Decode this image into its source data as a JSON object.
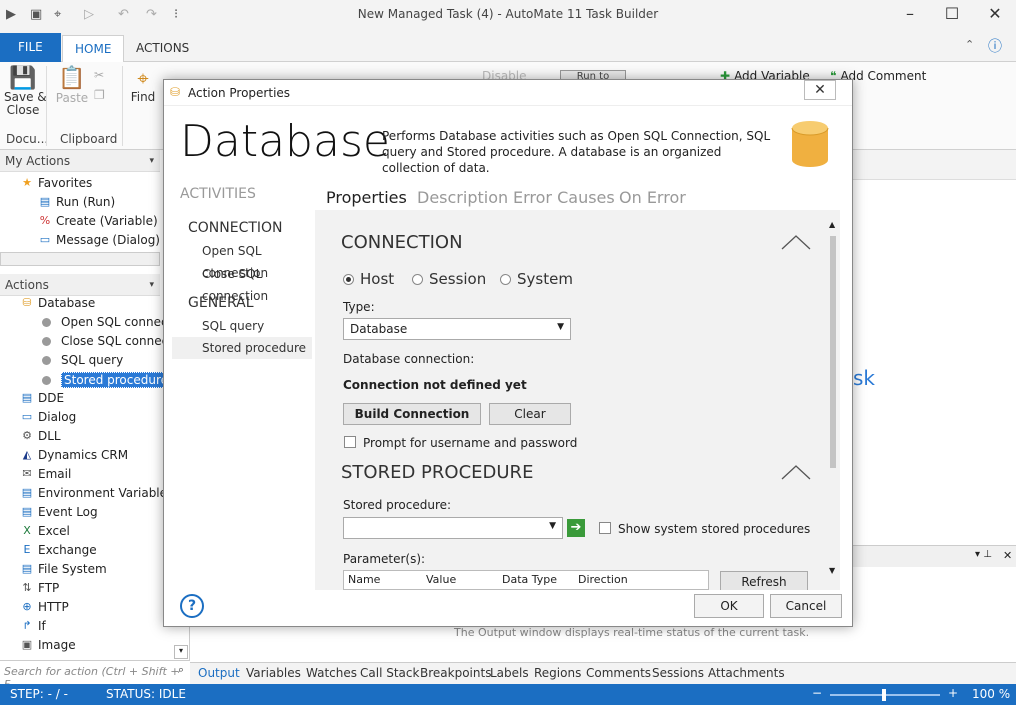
{
  "window": {
    "title": "New Managed Task (4) - AutoMate 11 Task Builder"
  },
  "ribbon_tabs": [
    "FILE",
    "HOME",
    "ACTIONS"
  ],
  "ribbon": {
    "save_close": "Save &\nClose",
    "save_close_caret": "▾",
    "docu": "Docu...",
    "paste": "Paste",
    "clipboard": "Clipboard",
    "find": "Find",
    "disable": "Disable",
    "add_variable": "Add Variable",
    "add_comment": "Add Comment",
    "run_to_cursor": "Run to cursor"
  },
  "left": {
    "my_actions": "My Actions",
    "favorites": "Favorites",
    "fav_items": [
      "Run (Run)",
      "Create (Variable)",
      "Message (Dialog)"
    ],
    "actions": "Actions",
    "database": "Database",
    "db_items": [
      "Open SQL connectio",
      "Close SQL connectio",
      "SQL query",
      "Stored procedure"
    ],
    "categories": [
      "DDE",
      "Dialog",
      "DLL",
      "Dynamics CRM",
      "Email",
      "Environment Variables",
      "Event Log",
      "Excel",
      "Exchange",
      "File System",
      "FTP",
      "HTTP",
      "If",
      "Image"
    ],
    "search_placeholder": "Search for action (Ctrl + Shift + F"
  },
  "bg_text": "sk",
  "output_text": "The Output window displays real-time status of the current task.",
  "bottom_tabs": [
    "Output",
    "Variables",
    "Watches",
    "Call Stack",
    "Breakpoints",
    "Labels",
    "Regions",
    "Comments",
    "Sessions",
    "Attachments"
  ],
  "status": {
    "step": "STEP: - / -",
    "status": "STATUS: IDLE",
    "zoom": "100 %"
  },
  "dialog": {
    "title": "Action Properties",
    "big_title": "Database",
    "description": "Performs Database activities such as Open SQL Connection, SQL query and Stored procedure. A database is an organized collection of data.",
    "activities": "ACTIVITIES",
    "sections": [
      {
        "label": "CONNECTION",
        "items": [
          "Open SQL connection",
          "Close SQL connection"
        ]
      },
      {
        "label": "GENERAL",
        "items": [
          "SQL query",
          "Stored procedure"
        ]
      }
    ],
    "tabs": [
      "Properties",
      "Description",
      "Error Causes",
      "On Error"
    ],
    "connection": {
      "header": "CONNECTION",
      "radios": [
        "Host",
        "Session",
        "System"
      ],
      "selected": "Host",
      "type_label": "Type:",
      "type_value": "Database",
      "db_conn_label": "Database connection:",
      "conn_status": "Connection not defined yet",
      "build_btn": "Build Connection",
      "clear_btn": "Clear",
      "prompt_label": "Prompt for username and password"
    },
    "stored": {
      "header": "STORED PROCEDURE",
      "proc_label": "Stored procedure:",
      "show_system": "Show system stored procedures",
      "params_label": "Parameter(s):",
      "param_cols": [
        "Name",
        "Value",
        "Data Type",
        "Direction"
      ],
      "refresh_btn": "Refresh"
    },
    "ok": "OK",
    "cancel": "Cancel",
    "help": "?"
  }
}
